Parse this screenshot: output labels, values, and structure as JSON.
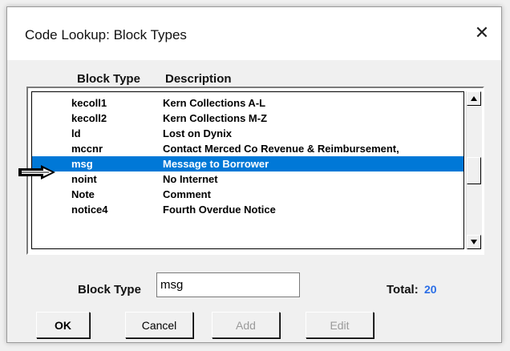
{
  "window": {
    "title": "Code Lookup: Block Types",
    "close_glyph": "✕"
  },
  "list": {
    "columns": [
      "Block Type",
      "Description"
    ],
    "rows": [
      {
        "code": "kecoll1",
        "description": "Kern Collections A-L"
      },
      {
        "code": "kecoll2",
        "description": "Kern Collections M-Z"
      },
      {
        "code": "ld",
        "description": "Lost on Dynix"
      },
      {
        "code": "mccnr",
        "description": "Contact Merced Co Revenue & Reimbursement,"
      },
      {
        "code": "msg",
        "description": "Message to Borrower"
      },
      {
        "code": "noint",
        "description": "No Internet"
      },
      {
        "code": "Note",
        "description": "Comment"
      },
      {
        "code": "notice4",
        "description": "Fourth Overdue Notice"
      }
    ],
    "selected_index": 4,
    "scroll_position": 0.5
  },
  "form": {
    "field_label": "Block Type",
    "field_value": "msg",
    "total_label": "Total:",
    "total_value": "20"
  },
  "buttons": {
    "ok": "OK",
    "cancel": "Cancel",
    "add": "Add",
    "edit": "Edit"
  },
  "colors": {
    "selection": "#0078d7",
    "total_value": "#2b6ee6",
    "disabled_text": "#9a9a9a"
  }
}
